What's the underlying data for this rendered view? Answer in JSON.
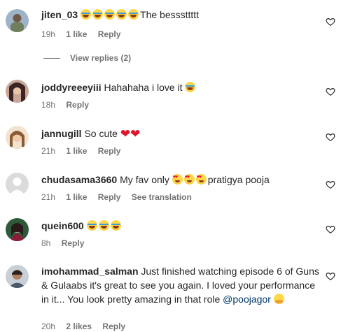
{
  "comments": [
    {
      "username": "jiten_03",
      "text": "The besssttttt",
      "time": "19h",
      "likes": "1 like",
      "reply": "Reply",
      "avatar_color": "#6f7f5e"
    },
    {
      "username": "joddyreeeyiii",
      "text": "Hahahaha i love it",
      "time": "18h",
      "reply": "Reply",
      "avatar_color": "#b06a6a"
    },
    {
      "username": "jannugill",
      "text": "So cute",
      "time": "21h",
      "likes": "1 like",
      "reply": "Reply",
      "avatar_color": "#d8b07a"
    },
    {
      "username": "chudasama3660",
      "text": "My fav only",
      "text_after": "pratigya pooja",
      "time": "21h",
      "likes": "1 like",
      "reply": "Reply",
      "translation": "See translation",
      "avatar_color": "#c7c7c7"
    },
    {
      "username": "quein600",
      "time": "8h",
      "reply": "Reply",
      "avatar_color": "#7a3a46"
    },
    {
      "username": "imohammad_salman",
      "text": "Just finished watching episode 6 of Guns & Gulaabs it's great to see you again. I loved your performance in it... You look pretty amazing in that role",
      "mention": "@poojagor",
      "time": "20h",
      "likes": "2 likes",
      "reply": "Reply",
      "avatar_color": "#4a5a6a"
    }
  ],
  "view_replies": "View replies (2)",
  "colors": {
    "text": "#262626",
    "meta": "#737373",
    "mention": "#00376b",
    "heart": "#e0152b"
  },
  "icons": {
    "like": "heart-outline-icon",
    "emoji_laugh": "laughing-tears-emoji",
    "emoji_heart_eyes": "heart-eyes-emoji",
    "emoji_hug": "hugging-emoji",
    "emoji_red_heart": "red-heart-emoji"
  }
}
